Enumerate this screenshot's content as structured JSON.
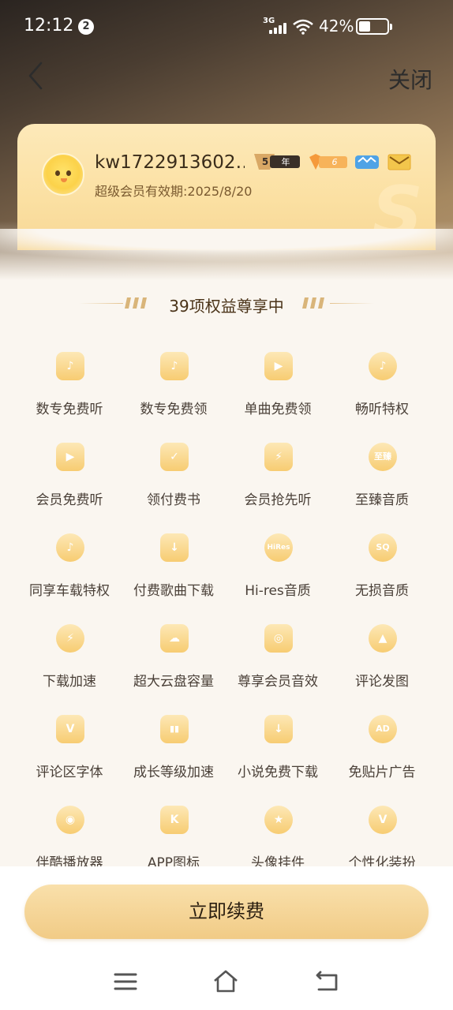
{
  "status_bar": {
    "time": "12:12",
    "notification_count": "2",
    "network": "3G",
    "battery_percent": "42%",
    "battery_level": 0.42
  },
  "nav": {
    "close_label": "关闭"
  },
  "member_card": {
    "username": "kw1722913602…",
    "expiry": "超级会员有效期:2025/8/20",
    "badges": [
      {
        "icon": "five-year-badge-icon",
        "text": "5",
        "suffix": "年"
      },
      {
        "icon": "level-badge-icon",
        "text": "6"
      },
      {
        "icon": "blue-crown-badge-icon"
      },
      {
        "icon": "mail-badge-icon"
      }
    ],
    "watermark": "S"
  },
  "section": {
    "title": "39项权益尊享中"
  },
  "benefits": [
    {
      "label": "数专免费听",
      "icon": "music-note-icon",
      "glyph": "♪"
    },
    {
      "label": "数专免费领",
      "icon": "music-box-icon",
      "glyph": "♪"
    },
    {
      "label": "单曲免费领",
      "icon": "play-disc-icon",
      "glyph": "▶"
    },
    {
      "label": "畅听特权",
      "icon": "crown-note-icon",
      "glyph": "♪"
    },
    {
      "label": "会员免费听",
      "icon": "play-card-icon",
      "glyph": "▶"
    },
    {
      "label": "领付费书",
      "icon": "book-check-icon",
      "glyph": "✓"
    },
    {
      "label": "会员抢先听",
      "icon": "lightning-icon",
      "glyph": "⚡"
    },
    {
      "label": "至臻音质",
      "icon": "master-quality-icon",
      "glyph": "至臻"
    },
    {
      "label": "同享车载特权",
      "icon": "car-music-icon",
      "glyph": "♪"
    },
    {
      "label": "付费歌曲下载",
      "icon": "download-cloud-icon",
      "glyph": "↓"
    },
    {
      "label": "Hi-res音质",
      "icon": "hires-icon",
      "glyph": "HiRes"
    },
    {
      "label": "无损音质",
      "icon": "sq-lossless-icon",
      "glyph": "SQ"
    },
    {
      "label": "下载加速",
      "icon": "fast-download-icon",
      "glyph": "⚡"
    },
    {
      "label": "超大云盘容量",
      "icon": "cloud-storage-icon",
      "glyph": "☁"
    },
    {
      "label": "尊享会员音效",
      "icon": "speaker-icon",
      "glyph": "◎"
    },
    {
      "label": "评论发图",
      "icon": "comment-image-icon",
      "glyph": "▲"
    },
    {
      "label": "评论区字体",
      "icon": "comment-font-icon",
      "glyph": "V"
    },
    {
      "label": "成长等级加速",
      "icon": "growth-chart-icon",
      "glyph": "▮▮"
    },
    {
      "label": "小说免费下载",
      "icon": "novel-download-icon",
      "glyph": "↓"
    },
    {
      "label": "免贴片广告",
      "icon": "no-ad-icon",
      "glyph": "AD"
    },
    {
      "label": "伴酷播放器",
      "icon": "player-disc-icon",
      "glyph": "◉"
    },
    {
      "label": "APP图标",
      "icon": "app-icon-icon",
      "glyph": "K"
    },
    {
      "label": "头像挂件",
      "icon": "avatar-pendant-icon",
      "glyph": "★"
    },
    {
      "label": "个性化装扮",
      "icon": "tshirt-icon",
      "glyph": "V"
    }
  ],
  "actions": {
    "renew_label": "立即续费"
  },
  "system_nav": {
    "menu_icon": "menu-icon",
    "home_icon": "home-icon",
    "back_icon": "back-return-icon"
  },
  "colors": {
    "accent_gold": "#f1cb86",
    "card_gold": "#fbe0a2",
    "text_dark": "#4a4038"
  }
}
